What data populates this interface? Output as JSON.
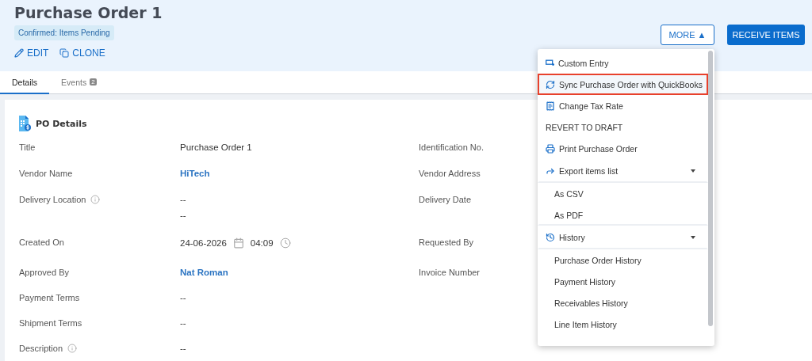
{
  "header": {
    "title": "Purchase Order 1",
    "status": "Confirmed: Items Pending",
    "actions": [
      "EDIT",
      "CLONE"
    ],
    "more_button": "MORE ▲",
    "primary_button": "RECEIVE ITEMS"
  },
  "tabs": [
    {
      "label": "Details",
      "selected": true
    },
    {
      "label": "Events",
      "badge": "2",
      "selected": false
    }
  ],
  "section": {
    "title": "PO Details"
  },
  "rows": [
    {
      "label": "Title",
      "info": false,
      "kind": "text",
      "values": [
        "Purchase Order 1"
      ],
      "right_label": "Identification No."
    },
    {
      "label": "Vendor Name",
      "info": false,
      "kind": "link",
      "values": [
        "HiTech"
      ],
      "right_label": "Vendor Address"
    },
    {
      "label": "Delivery Location",
      "info": true,
      "kind": "text",
      "values": [
        "--",
        "--"
      ],
      "right_label": "Delivery Date"
    },
    {
      "label": "Created On",
      "info": false,
      "kind": "datetime",
      "values": [
        "24-06-2026",
        "04:09"
      ],
      "right_label": "Requested By"
    },
    {
      "label": "Approved By",
      "info": false,
      "kind": "link",
      "values": [
        "Nat Roman"
      ],
      "right_label": "Invoice Number"
    },
    {
      "label": "Payment Terms",
      "info": false,
      "kind": "text",
      "values": [
        "--"
      ]
    },
    {
      "label": "Shipment Terms",
      "info": false,
      "kind": "text",
      "values": [
        "--"
      ]
    },
    {
      "label": "Description",
      "info": true,
      "kind": "text",
      "values": [
        "--"
      ]
    }
  ],
  "menu": [
    {
      "label": "Custom Entry",
      "kind": "action",
      "selected": false
    },
    {
      "label": "Sync Purchase Order with QuickBooks",
      "kind": "action",
      "selected": true
    },
    {
      "label": "Change Tax Rate",
      "kind": "action",
      "selected": false
    },
    {
      "label": "REVERT TO DRAFT",
      "kind": "plain",
      "selected": false
    },
    {
      "label": "Print Purchase Order",
      "kind": "action",
      "selected": false
    },
    {
      "label": "Export items list",
      "kind": "group",
      "selected": false
    },
    {
      "label": "As CSV",
      "kind": "sub",
      "selected": false
    },
    {
      "label": "As PDF",
      "kind": "sub",
      "selected": false
    },
    {
      "label": "History",
      "kind": "group",
      "selected": false
    },
    {
      "label": "Purchase Order History",
      "kind": "sub",
      "selected": false
    },
    {
      "label": "Payment History",
      "kind": "sub",
      "selected": false
    },
    {
      "label": "Receivables History",
      "kind": "sub",
      "selected": false
    },
    {
      "label": "Line Item History",
      "kind": "sub",
      "selected": false
    }
  ]
}
